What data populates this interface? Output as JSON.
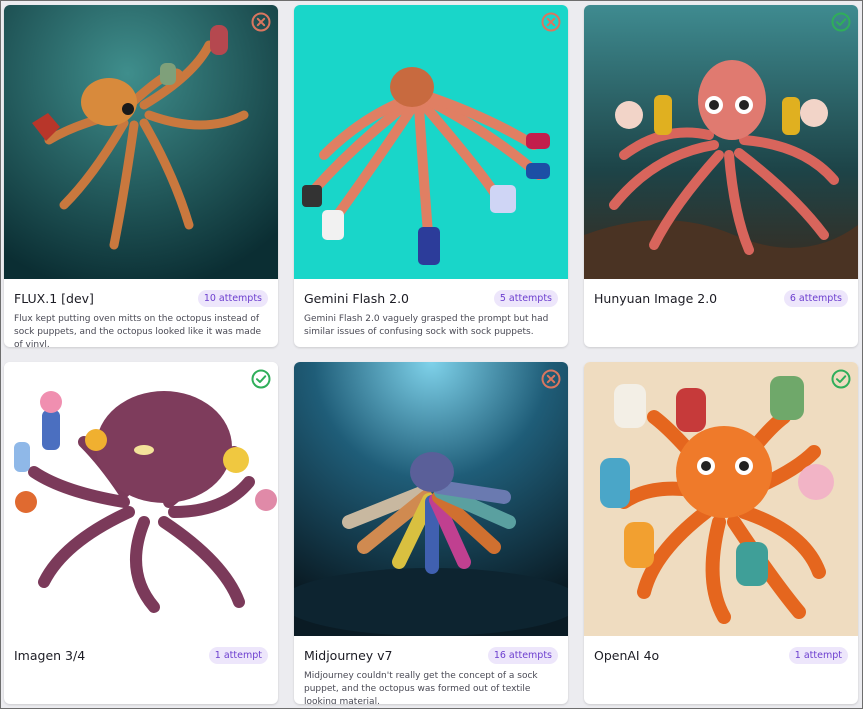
{
  "cards": [
    {
      "model": "FLUX.1 [dev]",
      "attempts": "10 attempts",
      "status": "fail",
      "status_icon": "x-circle-icon",
      "description": "Flux kept putting oven mitts on the octopus instead of sock puppets, and the octopus looked like it was made of vinyl."
    },
    {
      "model": "Gemini Flash 2.0",
      "attempts": "5 attempts",
      "status": "fail",
      "status_icon": "x-circle-icon",
      "description": "Gemini Flash 2.0 vaguely grasped the prompt but had similar issues of confusing sock with sock puppets."
    },
    {
      "model": "Hunyuan Image 2.0",
      "attempts": "6 attempts",
      "status": "pass",
      "status_icon": "check-circle-icon",
      "description": ""
    },
    {
      "model": "Imagen 3/4",
      "attempts": "1 attempt",
      "status": "pass",
      "status_icon": "check-circle-icon",
      "description": ""
    },
    {
      "model": "Midjourney v7",
      "attempts": "16 attempts",
      "status": "fail",
      "status_icon": "x-circle-icon",
      "description": "Midjourney couldn't really get the concept of a sock puppet, and the octopus was formed out of textile looking material."
    },
    {
      "model": "OpenAI 4o",
      "attempts": "1 attempt",
      "status": "pass",
      "status_icon": "check-circle-icon",
      "description": ""
    }
  ],
  "colors": {
    "fail": "#d9765f",
    "pass": "#2fae5a",
    "badge_text": "#6d3fcf",
    "badge_bg": "#ede6fb"
  }
}
